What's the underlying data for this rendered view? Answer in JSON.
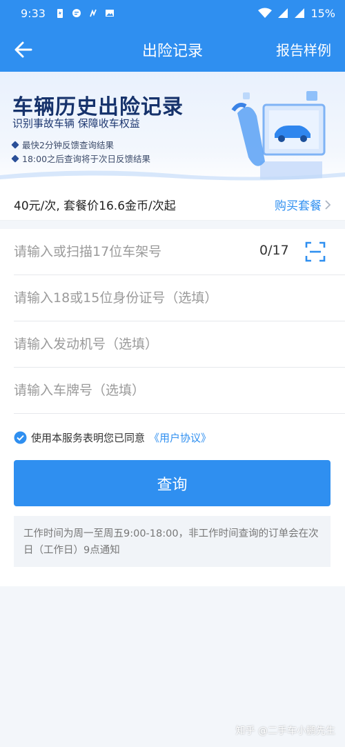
{
  "status_bar": {
    "time": "9:33",
    "battery": "15%"
  },
  "nav": {
    "title": "出险记录",
    "right_action": "报告样例"
  },
  "banner": {
    "title": "车辆历史出险记录",
    "subtitle": "识别事故车辆  保障收车权益",
    "bullets": [
      "最快2分钟反馈查询结果",
      "18:00之后查询将于次日反馈结果"
    ]
  },
  "price": {
    "text": "40元/次, 套餐价16.6金币/次起",
    "buy_label": "购买套餐"
  },
  "form": {
    "vin_placeholder": "请输入或扫描17位车架号",
    "vin_counter": "0/17",
    "id_placeholder": "请输入18或15位身份证号（选填）",
    "engine_placeholder": "请输入发动机号（选填）",
    "plate_placeholder": "请输入车牌号（选填）"
  },
  "agreement": {
    "text": "使用本服务表明您已同意",
    "link": "《用户协议》",
    "checked": true
  },
  "query_button": "查询",
  "notice": "工作时间为周一至周五9:00-18:00，非工作时间查询的订单会在次日（工作日）9点通知",
  "watermark": "知乎 @二手车小鹏先生",
  "colors": {
    "primary": "#2f8ff0",
    "banner_title": "#16326b",
    "page_bg": "#f3f6fa"
  },
  "icons": {
    "back": "arrow-left-icon",
    "scan": "scan-icon",
    "check": "check-circle-icon",
    "chevron": "chevron-right-icon"
  }
}
